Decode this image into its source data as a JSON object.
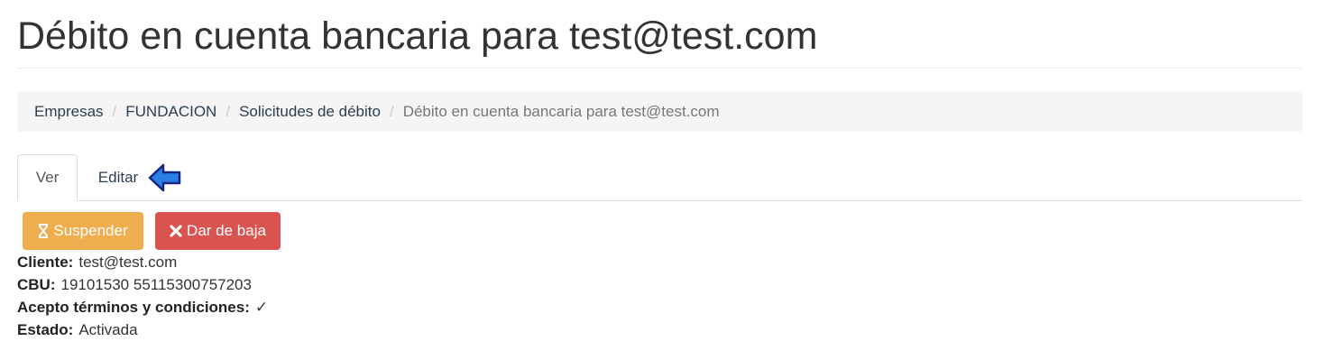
{
  "page": {
    "title": "Débito en cuenta bancaria para test@test.com"
  },
  "breadcrumb": {
    "items": [
      "Empresas",
      "FUNDACION",
      "Solicitudes de débito"
    ],
    "separator": "/",
    "active": "Débito en cuenta bancaria para test@test.com"
  },
  "tabs": {
    "items": [
      {
        "label": "Ver",
        "active": true
      },
      {
        "label": "Editar",
        "active": false
      }
    ],
    "annotation_icon": "blue-arrow-left-icon"
  },
  "actions": {
    "suspend": {
      "label": "Suspender",
      "icon": "hourglass-icon",
      "color": "#f0ad4e"
    },
    "cancel": {
      "label": "Dar de baja",
      "icon": "times-icon",
      "color": "#d9534f"
    }
  },
  "details": {
    "cliente": {
      "label": "Cliente:",
      "value": "test@test.com"
    },
    "cbu": {
      "label": "CBU:",
      "value": "19101530 55115300757203"
    },
    "terminos": {
      "label": "Acepto términos y condiciones:",
      "value": "✓"
    },
    "estado": {
      "label": "Estado:",
      "value": "Activada"
    }
  },
  "colors": {
    "link": "#2c3e50",
    "annotation_arrow": "#2a7fe6"
  }
}
